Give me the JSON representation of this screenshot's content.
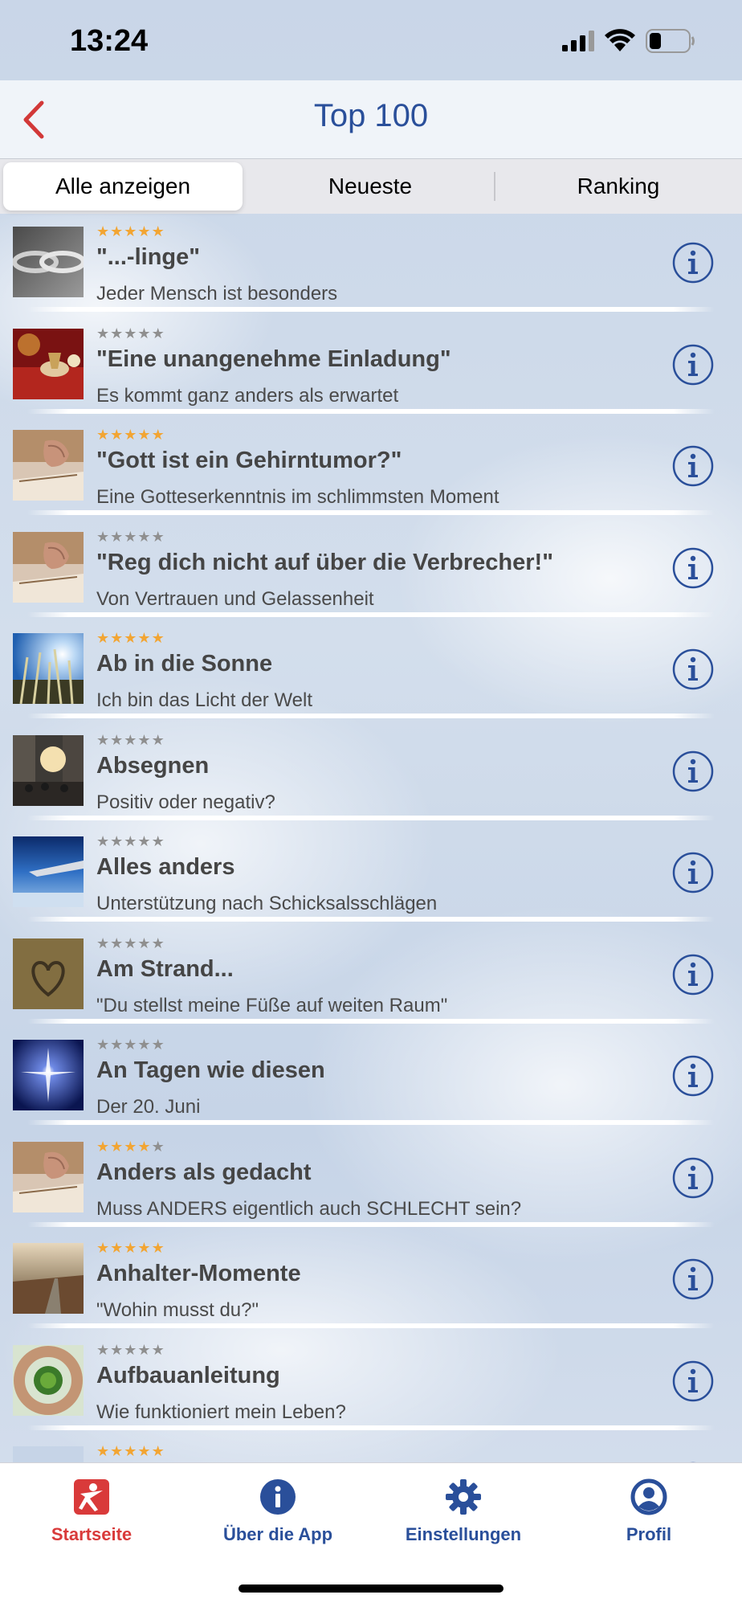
{
  "status_bar": {
    "time": "13:24"
  },
  "nav": {
    "title": "Top 100",
    "back_icon": "chevron-left-icon"
  },
  "segments": [
    {
      "label": "Alle anzeigen",
      "selected": true
    },
    {
      "label": "Neueste",
      "selected": false
    },
    {
      "label": "Ranking",
      "selected": false
    }
  ],
  "items": [
    {
      "title": "\"...-linge\"",
      "subtitle": "Jeder Mensch ist besonders",
      "rating": 5,
      "thumb": "chain"
    },
    {
      "title": "\"Eine unangenehme Einladung\"",
      "subtitle": "Es kommt ganz anders als erwartet",
      "rating": 0,
      "thumb": "red-table"
    },
    {
      "title": "\"Gott ist ein Gehirntumor?\"",
      "subtitle": "Eine Gotteserkenntnis im schlimmsten Moment",
      "rating": 5,
      "thumb": "praying-hands"
    },
    {
      "title": "\"Reg dich nicht auf über die Verbrecher!\"",
      "subtitle": "Von Vertrauen und Gelassenheit",
      "rating": 0,
      "thumb": "praying-hands"
    },
    {
      "title": "Ab in die Sonne",
      "subtitle": "Ich bin das Licht der Welt",
      "rating": 5,
      "thumb": "sun-grass"
    },
    {
      "title": "Absegnen",
      "subtitle": "Positiv oder negativ?",
      "rating": 0,
      "thumb": "street"
    },
    {
      "title": "Alles anders",
      "subtitle": "Unterstützung nach Schicksalsschlägen",
      "rating": 0,
      "thumb": "airplane-wing"
    },
    {
      "title": "Am Strand...",
      "subtitle": "\"Du stellst meine Füße auf weiten Raum\"",
      "rating": 0,
      "thumb": "sand-heart"
    },
    {
      "title": "An Tagen wie diesen",
      "subtitle": "Der 20. Juni",
      "rating": 0,
      "thumb": "star"
    },
    {
      "title": "Anders als gedacht",
      "subtitle": "Muss ANDERS eigentlich auch SCHLECHT sein?",
      "rating": 4,
      "thumb": "praying-hands"
    },
    {
      "title": "Anhalter-Momente",
      "subtitle": "\"Wohin musst du?\"",
      "rating": 5,
      "thumb": "road"
    },
    {
      "title": "Aufbauanleitung",
      "subtitle": "Wie funktioniert mein Leben?",
      "rating": 0,
      "thumb": "hands-circle"
    },
    {
      "title": "",
      "subtitle": "",
      "rating": 5,
      "thumb": "blue-heart"
    }
  ],
  "tabs": [
    {
      "label": "Startseite",
      "icon": "home-logo-icon",
      "active": true
    },
    {
      "label": "Über die App",
      "icon": "info-icon",
      "active": false
    },
    {
      "label": "Einstellungen",
      "icon": "gear-icon",
      "active": false
    },
    {
      "label": "Profil",
      "icon": "profile-icon",
      "active": false
    }
  ],
  "colors": {
    "accent_blue": "#2a4f9a",
    "accent_red": "#d93a3a",
    "star_gold": "#f2a533",
    "star_gray": "#8f8f8f"
  }
}
